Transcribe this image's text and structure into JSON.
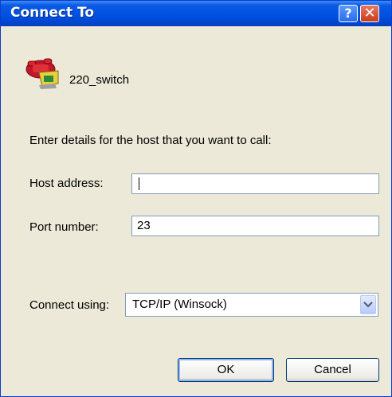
{
  "window": {
    "title": "Connect To"
  },
  "titlebar": {
    "help_label": "?",
    "close_label": "✕"
  },
  "connection": {
    "name": "220_switch",
    "icon": "telephone-icon"
  },
  "prompt": "Enter details for the host that you want to call:",
  "host": {
    "label": "Host address:",
    "value": ""
  },
  "port": {
    "label": "Port number:",
    "value": "23"
  },
  "connect_using": {
    "label": "Connect using:",
    "value": "TCP/IP (Winsock)"
  },
  "buttons": {
    "ok": "OK",
    "cancel": "Cancel"
  },
  "colors": {
    "titlebar": "#0050e0",
    "dialog_bg": "#ece9d8",
    "close_button": "#c83c1e"
  }
}
